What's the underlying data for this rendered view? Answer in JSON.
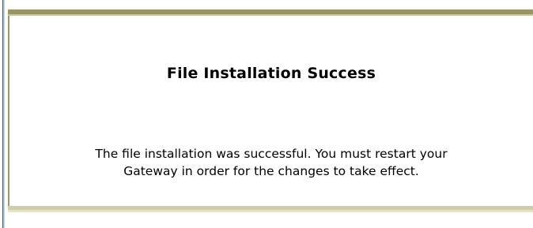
{
  "page": {
    "title": "File Installation Success",
    "message_lines": [
      "The file installation was successful. You must restart your",
      "Gateway in order for the changes to take effect."
    ]
  },
  "colors": {
    "frame_top": "#9a9660",
    "frame_bottom": "#cfcda6",
    "left_accent": "#2b5f8e",
    "text": "#000000",
    "background": "#ffffff"
  }
}
